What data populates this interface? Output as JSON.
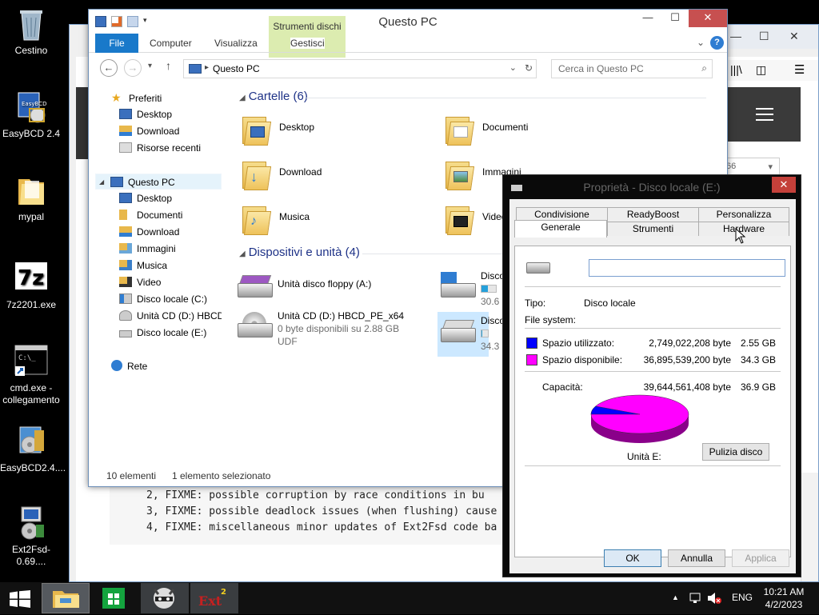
{
  "desktop": {
    "icons": [
      {
        "label": "Cestino",
        "icon": "recycle-bin-icon"
      },
      {
        "label": "EasyBCD 2.4",
        "icon": "easybcd-icon"
      },
      {
        "label": "mypal",
        "icon": "folder-icon"
      },
      {
        "label": "7z2201.exe",
        "icon": "7zip-icon"
      },
      {
        "label": "cmd.exe - collegamento",
        "icon": "cmd-icon"
      },
      {
        "label": "EasyBCD2.4....",
        "icon": "installer-icon"
      },
      {
        "label": "Ext2Fsd-0.69....",
        "icon": "ext2fsd-icon"
      }
    ]
  },
  "browser": {
    "code_lines": [
      "2, FIXME: possible corruption by race conditions in bu",
      "3, FIXME: possible deadlock issues (when flushing) cause",
      "4, FIXME: miscellaneous minor updates of Ext2Fsd code ba"
    ],
    "badge": "66"
  },
  "explorer": {
    "title": "Questo PC",
    "contextual_tab_group": "Strumenti dischi",
    "ribbon_tabs": {
      "file": "File",
      "computer": "Computer",
      "view": "Visualizza",
      "manage": "Gestisci"
    },
    "address": "Questo PC",
    "search_placeholder": "Cerca in Questo PC",
    "nav": {
      "favorites": "Preferiti",
      "fav_items": [
        "Desktop",
        "Download",
        "Risorse recenti"
      ],
      "this_pc": "Questo PC",
      "pc_items": [
        "Desktop",
        "Documenti",
        "Download",
        "Immagini",
        "Musica",
        "Video",
        "Disco locale (C:)",
        "Unità CD (D:) HBCD_",
        "Disco locale (E:)"
      ],
      "network": "Rete"
    },
    "folders_header": "Cartelle (6)",
    "folders": [
      "Desktop",
      "Documenti",
      "Download",
      "Immagini",
      "Musica",
      "Video"
    ],
    "devices_header": "Dispositivi e unità (4)",
    "devices": [
      {
        "name": "Unità disco floppy (A:)"
      },
      {
        "name": "Unità CD (D:) HBCD_PE_x64",
        "sub1": "0 byte disponibili su 2.88 GB",
        "sub2": "UDF"
      },
      {
        "name": "Disco",
        "sub1": "30.6",
        "used_fraction": 0.45
      },
      {
        "name": "Disco",
        "sub1": "34.3",
        "used_fraction": 0.07
      }
    ],
    "status": {
      "count": "10 elementi",
      "selected": "1 elemento selezionato"
    }
  },
  "properties": {
    "title": "Proprietà - Disco locale (E:)",
    "tabs_row1": [
      "Condivisione",
      "ReadyBoost",
      "Personalizza"
    ],
    "tabs_row2": [
      "Generale",
      "Strumenti",
      "Hardware"
    ],
    "type_label": "Tipo:",
    "type_value": "Disco locale",
    "fs_label": "File system:",
    "used_label": "Spazio utilizzato:",
    "used_bytes": "2,749,022,208 byte",
    "used_gb": "2.55 GB",
    "free_label": "Spazio disponibile:",
    "free_bytes": "36,895,539,200 byte",
    "free_gb": "34.3 GB",
    "capacity_label": "Capacità:",
    "capacity_bytes": "39,644,561,408 byte",
    "capacity_gb": "36.9 GB",
    "drive_label": "Unità E:",
    "cleanup_button": "Pulizia disco",
    "ok_button": "OK",
    "cancel_button": "Annulla",
    "apply_button": "Applica",
    "used_color": "#0000ff",
    "free_color": "#ff00ff",
    "used_fraction": 0.069
  },
  "taskbar": {
    "language": "ENG",
    "time": "10:21 AM",
    "date": "4/2/2023"
  }
}
